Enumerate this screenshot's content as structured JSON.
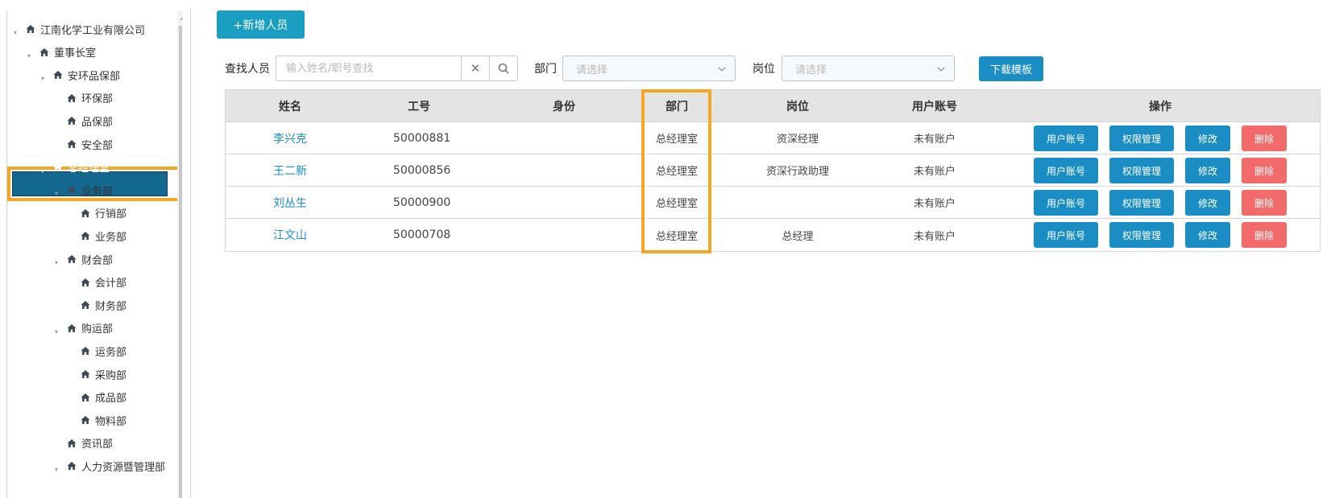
{
  "sidebar": {
    "tree": [
      {
        "label": "江南化学工业有限公司",
        "level": 0,
        "expanded": true
      },
      {
        "label": "董事长室",
        "level": 1,
        "expanded": true
      },
      {
        "label": "安环品保部",
        "level": 2,
        "expanded": true
      },
      {
        "label": "环保部",
        "level": 3
      },
      {
        "label": "品保部",
        "level": 3
      },
      {
        "label": "安全部",
        "level": 3
      },
      {
        "label": "总经理室",
        "level": 2,
        "expanded": true,
        "selected": true
      },
      {
        "label": "业务部",
        "level": 3,
        "expanded": true
      },
      {
        "label": "行销部",
        "level": 4
      },
      {
        "label": "业务部",
        "level": 4
      },
      {
        "label": "财会部",
        "level": 3,
        "expanded": true
      },
      {
        "label": "会计部",
        "level": 4
      },
      {
        "label": "财务部",
        "level": 4
      },
      {
        "label": "购运部",
        "level": 3,
        "expanded": true
      },
      {
        "label": "运务部",
        "level": 4
      },
      {
        "label": "采购部",
        "level": 4
      },
      {
        "label": "成品部",
        "level": 4
      },
      {
        "label": "物料部",
        "level": 4
      },
      {
        "label": "资讯部",
        "level": 3
      },
      {
        "label": "人力资源暨管理部",
        "level": 3,
        "expanded": true
      }
    ]
  },
  "toolbar": {
    "add_label": "+新增人员",
    "search_label": "查找人员",
    "search_placeholder": "输入姓名/职号查找",
    "dept_label": "部门",
    "dept_placeholder": "请选择",
    "post_label": "岗位",
    "post_placeholder": "请选择",
    "download_label": "下载模板"
  },
  "table": {
    "headers": [
      "姓名",
      "工号",
      "身份",
      "部门",
      "岗位",
      "用户账号",
      "操作"
    ],
    "rows": [
      {
        "name": "李兴克",
        "id": "50000881",
        "identity": "",
        "dept": "总经理室",
        "post": "资深经理",
        "account": "未有账户"
      },
      {
        "name": "王二新",
        "id": "50000856",
        "identity": "",
        "dept": "总经理室",
        "post": "资深行政助理",
        "account": "未有账户"
      },
      {
        "name": "刘丛生",
        "id": "50000900",
        "identity": "",
        "dept": "总经理室",
        "post": "",
        "account": "未有账户"
      },
      {
        "name": "江文山",
        "id": "50000708",
        "identity": "",
        "dept": "总经理室",
        "post": "总经理",
        "account": "未有账户"
      }
    ],
    "ops": {
      "account": "用户账号",
      "perm": "权限管理",
      "edit": "修改",
      "delete": "删除"
    }
  },
  "colors": {
    "primary": "#1a8dc4",
    "danger": "#f26a6a",
    "highlight": "#f5a623",
    "selected": "#13688f"
  }
}
